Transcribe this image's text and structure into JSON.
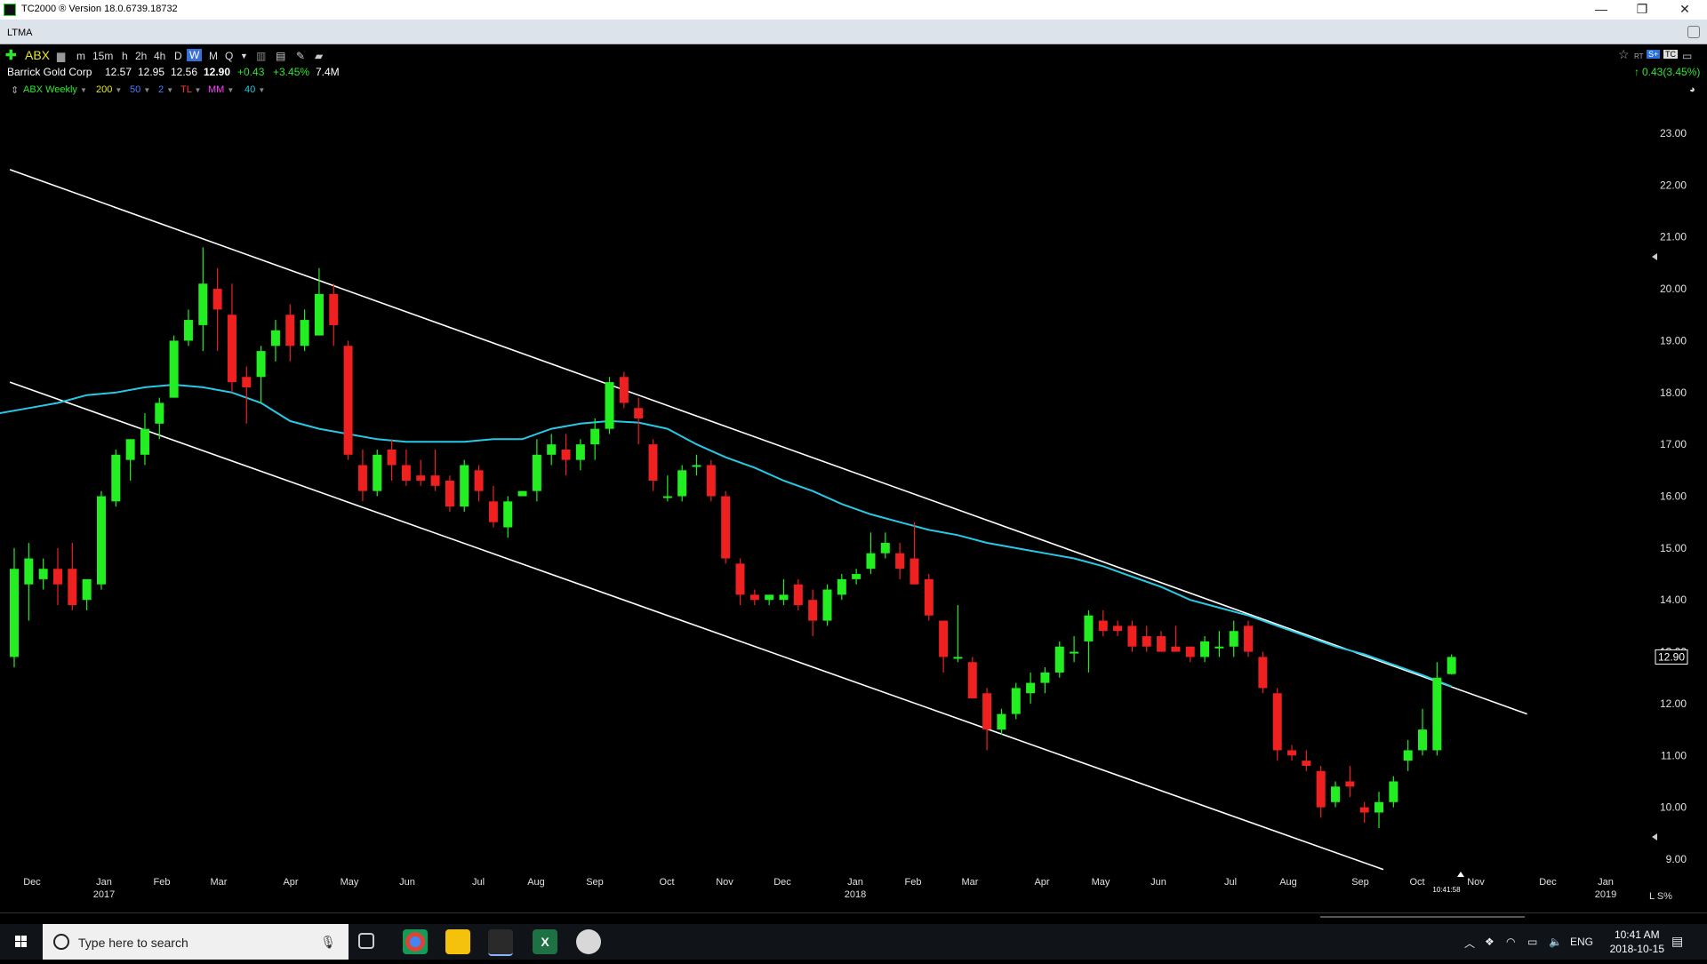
{
  "window": {
    "title": "TC2000 ® Version 18.0.6739.18732",
    "controls": {
      "minimize": "—",
      "restore": "❐",
      "close": "✕"
    }
  },
  "layout": {
    "name": "LTMA"
  },
  "toolbar": {
    "symbol": "ABX",
    "timeframes": [
      "m",
      "15m",
      "h",
      "2h",
      "4h",
      "D",
      "W",
      "M",
      "Q"
    ],
    "active_timeframe": "W"
  },
  "quote": {
    "company": "Barrick Gold Corp",
    "open": "12.57",
    "high": "12.95",
    "low": "12.56",
    "last": "12.90",
    "change": "+0.43",
    "change_pct": "+3.45%",
    "volume": "7.4M",
    "right_change": "0.43(3.45%)"
  },
  "indicators": [
    {
      "label": "ABX Weekly",
      "color": "#2fe62f"
    },
    {
      "label": "200",
      "color": "#e8e820"
    },
    {
      "label": "50",
      "color": "#4a7dff"
    },
    {
      "label": "2",
      "color": "#4a7dff"
    },
    {
      "label": "TL",
      "color": "#ff3b3b"
    },
    {
      "label": "MM",
      "color": "#ff40ff"
    },
    {
      "label": "40",
      "color": "#27c9e6"
    }
  ],
  "chart_data": {
    "type": "candlestick",
    "symbol": "ABX",
    "period": "Weekly",
    "y_axis": {
      "min": 9.0,
      "max": 23.0,
      "ticks": [
        "23.00",
        "22.00",
        "21.00",
        "20.00",
        "19.00",
        "18.00",
        "17.00",
        "16.00",
        "15.00",
        "14.00",
        "13.00",
        "12.00",
        "11.00",
        "10.00",
        "9.00"
      ]
    },
    "last_price_label": "12.90",
    "x_labels": [
      {
        "label": "Dec",
        "year": ""
      },
      {
        "label": "Jan",
        "year": "2017"
      },
      {
        "label": "Feb",
        "year": ""
      },
      {
        "label": "Mar",
        "year": ""
      },
      {
        "label": "Apr",
        "year": ""
      },
      {
        "label": "May",
        "year": ""
      },
      {
        "label": "Jun",
        "year": ""
      },
      {
        "label": "Jul",
        "year": ""
      },
      {
        "label": "Aug",
        "year": ""
      },
      {
        "label": "Sep",
        "year": ""
      },
      {
        "label": "Oct",
        "year": ""
      },
      {
        "label": "Nov",
        "year": ""
      },
      {
        "label": "Dec",
        "year": ""
      },
      {
        "label": "Jan",
        "year": "2018"
      },
      {
        "label": "Feb",
        "year": ""
      },
      {
        "label": "Mar",
        "year": ""
      },
      {
        "label": "Apr",
        "year": ""
      },
      {
        "label": "May",
        "year": ""
      },
      {
        "label": "Jun",
        "year": ""
      },
      {
        "label": "Jul",
        "year": ""
      },
      {
        "label": "Aug",
        "year": ""
      },
      {
        "label": "Sep",
        "year": ""
      },
      {
        "label": "Oct",
        "year": ""
      },
      {
        "label": "Nov",
        "year": ""
      },
      {
        "label": "Dec",
        "year": ""
      },
      {
        "label": "Jan",
        "year": "2019"
      }
    ],
    "time_marker": "10:41:58",
    "scale_mode": "L  S%",
    "candles": [
      {
        "o": 12.9,
        "h": 15.0,
        "l": 12.7,
        "c": 14.6
      },
      {
        "o": 14.3,
        "h": 15.1,
        "l": 13.6,
        "c": 14.8
      },
      {
        "o": 14.4,
        "h": 14.8,
        "l": 14.2,
        "c": 14.6
      },
      {
        "o": 14.6,
        "h": 15.0,
        "l": 13.9,
        "c": 14.3
      },
      {
        "o": 14.6,
        "h": 15.1,
        "l": 13.8,
        "c": 13.9
      },
      {
        "o": 14.0,
        "h": 14.4,
        "l": 13.8,
        "c": 14.4
      },
      {
        "o": 14.3,
        "h": 16.1,
        "l": 14.2,
        "c": 16.0
      },
      {
        "o": 15.9,
        "h": 16.9,
        "l": 15.8,
        "c": 16.8
      },
      {
        "o": 16.7,
        "h": 17.1,
        "l": 16.3,
        "c": 17.1
      },
      {
        "o": 16.8,
        "h": 17.6,
        "l": 16.6,
        "c": 17.3
      },
      {
        "o": 17.4,
        "h": 17.9,
        "l": 17.1,
        "c": 17.8
      },
      {
        "o": 17.9,
        "h": 19.1,
        "l": 17.9,
        "c": 19.0
      },
      {
        "o": 19.0,
        "h": 19.6,
        "l": 18.9,
        "c": 19.4
      },
      {
        "o": 19.3,
        "h": 20.8,
        "l": 18.8,
        "c": 20.1
      },
      {
        "o": 20.0,
        "h": 20.4,
        "l": 18.8,
        "c": 19.6
      },
      {
        "o": 19.5,
        "h": 20.1,
        "l": 18.0,
        "c": 18.2
      },
      {
        "o": 18.3,
        "h": 18.5,
        "l": 17.4,
        "c": 18.1
      },
      {
        "o": 18.3,
        "h": 18.9,
        "l": 17.8,
        "c": 18.8
      },
      {
        "o": 18.9,
        "h": 19.4,
        "l": 18.6,
        "c": 19.2
      },
      {
        "o": 19.5,
        "h": 19.7,
        "l": 18.6,
        "c": 18.9
      },
      {
        "o": 18.9,
        "h": 19.6,
        "l": 18.8,
        "c": 19.4
      },
      {
        "o": 19.1,
        "h": 20.4,
        "l": 19.1,
        "c": 19.9
      },
      {
        "o": 19.9,
        "h": 20.1,
        "l": 18.9,
        "c": 19.3
      },
      {
        "o": 18.9,
        "h": 19.0,
        "l": 16.7,
        "c": 16.8
      },
      {
        "o": 16.6,
        "h": 16.9,
        "l": 15.9,
        "c": 16.1
      },
      {
        "o": 16.1,
        "h": 16.9,
        "l": 16.0,
        "c": 16.8
      },
      {
        "o": 16.9,
        "h": 17.1,
        "l": 16.3,
        "c": 16.6
      },
      {
        "o": 16.6,
        "h": 16.9,
        "l": 16.2,
        "c": 16.3
      },
      {
        "o": 16.4,
        "h": 16.7,
        "l": 16.2,
        "c": 16.3
      },
      {
        "o": 16.4,
        "h": 16.9,
        "l": 16.1,
        "c": 16.2
      },
      {
        "o": 16.3,
        "h": 16.4,
        "l": 15.7,
        "c": 15.8
      },
      {
        "o": 15.8,
        "h": 16.7,
        "l": 15.7,
        "c": 16.6
      },
      {
        "o": 16.5,
        "h": 16.6,
        "l": 15.9,
        "c": 16.1
      },
      {
        "o": 15.9,
        "h": 16.2,
        "l": 15.4,
        "c": 15.5
      },
      {
        "o": 15.4,
        "h": 16.0,
        "l": 15.2,
        "c": 15.9
      },
      {
        "o": 16.0,
        "h": 16.1,
        "l": 16.0,
        "c": 16.1
      },
      {
        "o": 16.1,
        "h": 17.1,
        "l": 15.9,
        "c": 16.8
      },
      {
        "o": 16.8,
        "h": 17.2,
        "l": 16.6,
        "c": 17.0
      },
      {
        "o": 16.9,
        "h": 17.2,
        "l": 16.4,
        "c": 16.7
      },
      {
        "o": 16.7,
        "h": 17.1,
        "l": 16.5,
        "c": 17.0
      },
      {
        "o": 17.0,
        "h": 17.5,
        "l": 16.7,
        "c": 17.3
      },
      {
        "o": 17.3,
        "h": 18.3,
        "l": 17.2,
        "c": 18.2
      },
      {
        "o": 18.3,
        "h": 18.4,
        "l": 17.7,
        "c": 17.8
      },
      {
        "o": 17.7,
        "h": 17.9,
        "l": 17.0,
        "c": 17.5
      },
      {
        "o": 17.0,
        "h": 17.1,
        "l": 16.1,
        "c": 16.3
      },
      {
        "o": 16.0,
        "h": 16.4,
        "l": 15.9,
        "c": 16.0
      },
      {
        "o": 16.0,
        "h": 16.6,
        "l": 15.9,
        "c": 16.5
      },
      {
        "o": 16.6,
        "h": 16.8,
        "l": 16.4,
        "c": 16.6
      },
      {
        "o": 16.6,
        "h": 16.7,
        "l": 15.9,
        "c": 16.0
      },
      {
        "o": 16.0,
        "h": 16.1,
        "l": 14.7,
        "c": 14.8
      },
      {
        "o": 14.7,
        "h": 14.8,
        "l": 13.9,
        "c": 14.1
      },
      {
        "o": 14.1,
        "h": 14.2,
        "l": 13.9,
        "c": 14.0
      },
      {
        "o": 14.0,
        "h": 14.1,
        "l": 13.9,
        "c": 14.1
      },
      {
        "o": 14.0,
        "h": 14.4,
        "l": 13.9,
        "c": 14.1
      },
      {
        "o": 14.3,
        "h": 14.4,
        "l": 13.8,
        "c": 13.9
      },
      {
        "o": 14.0,
        "h": 14.2,
        "l": 13.3,
        "c": 13.6
      },
      {
        "o": 13.6,
        "h": 14.3,
        "l": 13.5,
        "c": 14.2
      },
      {
        "o": 14.1,
        "h": 14.5,
        "l": 14.0,
        "c": 14.4
      },
      {
        "o": 14.4,
        "h": 14.6,
        "l": 14.3,
        "c": 14.5
      },
      {
        "o": 14.6,
        "h": 15.3,
        "l": 14.5,
        "c": 14.9
      },
      {
        "o": 14.9,
        "h": 15.3,
        "l": 14.8,
        "c": 15.1
      },
      {
        "o": 14.9,
        "h": 15.1,
        "l": 14.4,
        "c": 14.6
      },
      {
        "o": 14.8,
        "h": 15.5,
        "l": 14.3,
        "c": 14.3
      },
      {
        "o": 14.4,
        "h": 14.5,
        "l": 13.6,
        "c": 13.7
      },
      {
        "o": 13.6,
        "h": 13.6,
        "l": 12.6,
        "c": 12.9
      },
      {
        "o": 12.9,
        "h": 13.9,
        "l": 12.8,
        "c": 12.9
      },
      {
        "o": 12.8,
        "h": 12.9,
        "l": 12.1,
        "c": 12.1
      },
      {
        "o": 12.2,
        "h": 12.3,
        "l": 11.1,
        "c": 11.5
      },
      {
        "o": 11.5,
        "h": 11.9,
        "l": 11.4,
        "c": 11.8
      },
      {
        "o": 11.8,
        "h": 12.4,
        "l": 11.7,
        "c": 12.3
      },
      {
        "o": 12.2,
        "h": 12.6,
        "l": 12.0,
        "c": 12.4
      },
      {
        "o": 12.4,
        "h": 12.7,
        "l": 12.2,
        "c": 12.6
      },
      {
        "o": 12.6,
        "h": 13.2,
        "l": 12.5,
        "c": 13.1
      },
      {
        "o": 13.0,
        "h": 13.3,
        "l": 12.8,
        "c": 13.0
      },
      {
        "o": 13.2,
        "h": 13.8,
        "l": 12.6,
        "c": 13.7
      },
      {
        "o": 13.6,
        "h": 13.8,
        "l": 13.3,
        "c": 13.4
      },
      {
        "o": 13.5,
        "h": 13.6,
        "l": 13.3,
        "c": 13.4
      },
      {
        "o": 13.5,
        "h": 13.6,
        "l": 13.0,
        "c": 13.1
      },
      {
        "o": 13.3,
        "h": 13.5,
        "l": 13.0,
        "c": 13.1
      },
      {
        "o": 13.3,
        "h": 13.4,
        "l": 13.0,
        "c": 13.0
      },
      {
        "o": 13.1,
        "h": 13.5,
        "l": 13.0,
        "c": 13.0
      },
      {
        "o": 13.1,
        "h": 13.1,
        "l": 12.8,
        "c": 12.9
      },
      {
        "o": 12.9,
        "h": 13.3,
        "l": 12.8,
        "c": 13.2
      },
      {
        "o": 13.1,
        "h": 13.4,
        "l": 12.9,
        "c": 13.1
      },
      {
        "o": 13.1,
        "h": 13.6,
        "l": 12.9,
        "c": 13.4
      },
      {
        "o": 13.5,
        "h": 13.6,
        "l": 12.9,
        "c": 13.0
      },
      {
        "o": 12.9,
        "h": 13.0,
        "l": 12.2,
        "c": 12.3
      },
      {
        "o": 12.2,
        "h": 12.3,
        "l": 10.9,
        "c": 11.1
      },
      {
        "o": 11.1,
        "h": 11.2,
        "l": 10.9,
        "c": 11.0
      },
      {
        "o": 10.9,
        "h": 11.1,
        "l": 10.7,
        "c": 10.8
      },
      {
        "o": 10.7,
        "h": 10.8,
        "l": 9.8,
        "c": 10.0
      },
      {
        "o": 10.1,
        "h": 10.5,
        "l": 10.0,
        "c": 10.4
      },
      {
        "o": 10.5,
        "h": 10.8,
        "l": 10.2,
        "c": 10.4
      },
      {
        "o": 10.0,
        "h": 10.1,
        "l": 9.7,
        "c": 9.9
      },
      {
        "o": 9.9,
        "h": 10.3,
        "l": 9.6,
        "c": 10.1
      },
      {
        "o": 10.1,
        "h": 10.6,
        "l": 10.0,
        "c": 10.5
      },
      {
        "o": 10.9,
        "h": 11.3,
        "l": 10.7,
        "c": 11.1
      },
      {
        "o": 11.1,
        "h": 11.9,
        "l": 11.0,
        "c": 11.5
      },
      {
        "o": 11.1,
        "h": 12.8,
        "l": 11.0,
        "c": 12.5
      },
      {
        "o": 12.57,
        "h": 12.95,
        "l": 12.56,
        "c": 12.9
      }
    ],
    "moving_average": {
      "period": 40,
      "color": "#27c9e6",
      "values": [
        17.6,
        17.7,
        17.8,
        17.95,
        18.0,
        18.1,
        18.15,
        18.1,
        18.0,
        17.8,
        17.45,
        17.3,
        17.2,
        17.1,
        17.05,
        17.05,
        17.05,
        17.1,
        17.1,
        17.3,
        17.4,
        17.45,
        17.42,
        17.3,
        17.0,
        16.75,
        16.55,
        16.3,
        16.1,
        15.85,
        15.65,
        15.5,
        15.35,
        15.25,
        15.1,
        15.0,
        14.9,
        14.8,
        14.65,
        14.45,
        14.25,
        14.0,
        13.85,
        13.7,
        13.5,
        13.3,
        13.1,
        12.95,
        12.75,
        12.55,
        12.33
      ]
    },
    "trendlines": [
      {
        "from": {
          "i": -0.3,
          "y": 22.3
        },
        "to": {
          "i": 104.2,
          "y": 11.8
        }
      },
      {
        "from": {
          "i": -0.3,
          "y": 18.2
        },
        "to": {
          "i": 94.3,
          "y": 8.8
        }
      }
    ],
    "colors": {
      "up": "#22ee22",
      "down": "#ee2020",
      "trendline": "#ffffff",
      "axis_text": "#e0e0e0"
    }
  },
  "taskbar": {
    "search_placeholder": "Type here to search",
    "language": "ENG",
    "time": "10:41 AM",
    "date": "2018-10-15"
  }
}
